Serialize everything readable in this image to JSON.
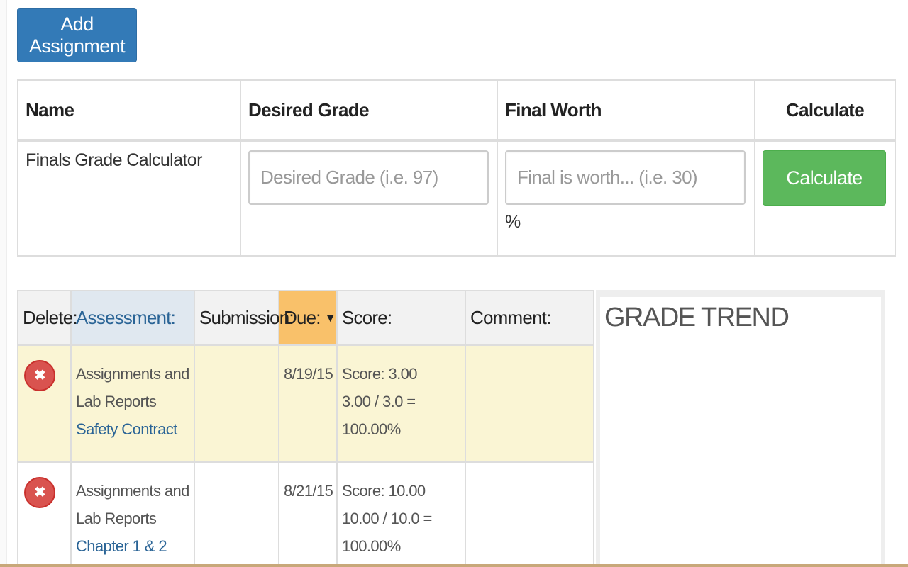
{
  "toolbar": {
    "add_assignment_label": "Add Assignment"
  },
  "calculator": {
    "headers": {
      "name": "Name",
      "desired_grade": "Desired Grade",
      "final_worth": "Final Worth",
      "calculate": "Calculate"
    },
    "row": {
      "name": "Finals Grade Calculator",
      "desired_grade_value": "",
      "desired_grade_placeholder": "Desired Grade (i.e. 97)",
      "final_worth_value": "",
      "final_worth_placeholder": "Final is worth... (i.e. 30)",
      "percent_sign": "%",
      "calculate_button": "Calculate"
    }
  },
  "grades": {
    "headers": {
      "delete": "Delete:",
      "assessment": "Assessment:",
      "submission": "Submission:",
      "due": "Due:",
      "due_sort_icon": "▼",
      "score": "Score:",
      "comment": "Comment:"
    },
    "rows": [
      {
        "delete_icon": "✖",
        "category": "Assignments and Lab Reports",
        "assignment": "Safety Contract",
        "submission": "",
        "due": "8/19/15",
        "score": "Score: 3.00",
        "score_detail": "3.00 / 3.0 = 100.00%",
        "comment": "",
        "highlighted": true
      },
      {
        "delete_icon": "✖",
        "category": "Assignments and Lab Reports",
        "assignment": "Chapter 1 & 2",
        "submission": "",
        "due": "8/21/15",
        "score": "Score: 10.00",
        "score_detail": "10.00 / 10.0 = 100.00%",
        "comment": "",
        "highlighted": false
      }
    ]
  },
  "trend": {
    "title": "GRADE TREND"
  },
  "colors": {
    "primary": "#337ab7",
    "success": "#5cb85c",
    "danger": "#d9534f",
    "row_highlight": "#faf5d4",
    "due_header": "#f9c16a",
    "assessment_header": "#e0e8f0",
    "link": "#2a6496"
  }
}
